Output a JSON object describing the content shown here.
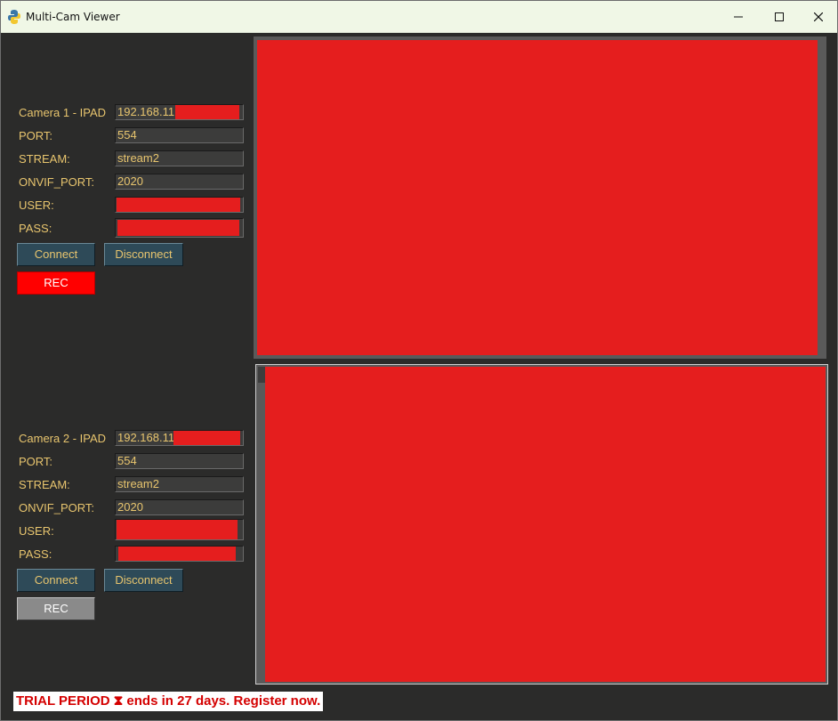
{
  "window": {
    "title": "Multi-Cam Viewer",
    "controls": [
      "minimize",
      "maximize",
      "close"
    ]
  },
  "camera1": {
    "label": "Camera 1 - IPAD",
    "ip_value": "192.168.11",
    "port_label": "PORT:",
    "port_value": "554",
    "stream_label": "STREAM:",
    "stream_value": "stream2",
    "onvif_label": "ONVIF_PORT:",
    "onvif_value": "2020",
    "user_label": "USER:",
    "pass_label": "PASS:",
    "connect_label": "Connect",
    "disconnect_label": "Disconnect",
    "rec_label": "REC",
    "rec_state": "recording"
  },
  "camera2": {
    "label": "Camera 2 - IPAD",
    "ip_value": "192.168.11",
    "port_label": "PORT:",
    "port_value": "554",
    "stream_label": "STREAM:",
    "stream_value": "stream2",
    "onvif_label": "ONVIF_PORT:",
    "onvif_value": "2020",
    "user_label": "USER:",
    "pass_label": "PASS:",
    "connect_label": "Connect",
    "disconnect_label": "Disconnect",
    "rec_label": "REC",
    "rec_state": "idle"
  },
  "trial_banner": "TRIAL PERIOD ⧗ ends in 27 days. Register now.",
  "colors": {
    "background": "#2b2b2a",
    "label_text": "#e8c56e",
    "button_bg": "#2e4a58",
    "rec_active": "#ff0000",
    "rec_idle": "#8a8a8a",
    "redaction": "#e51e1e",
    "trial_text": "#d40000"
  }
}
